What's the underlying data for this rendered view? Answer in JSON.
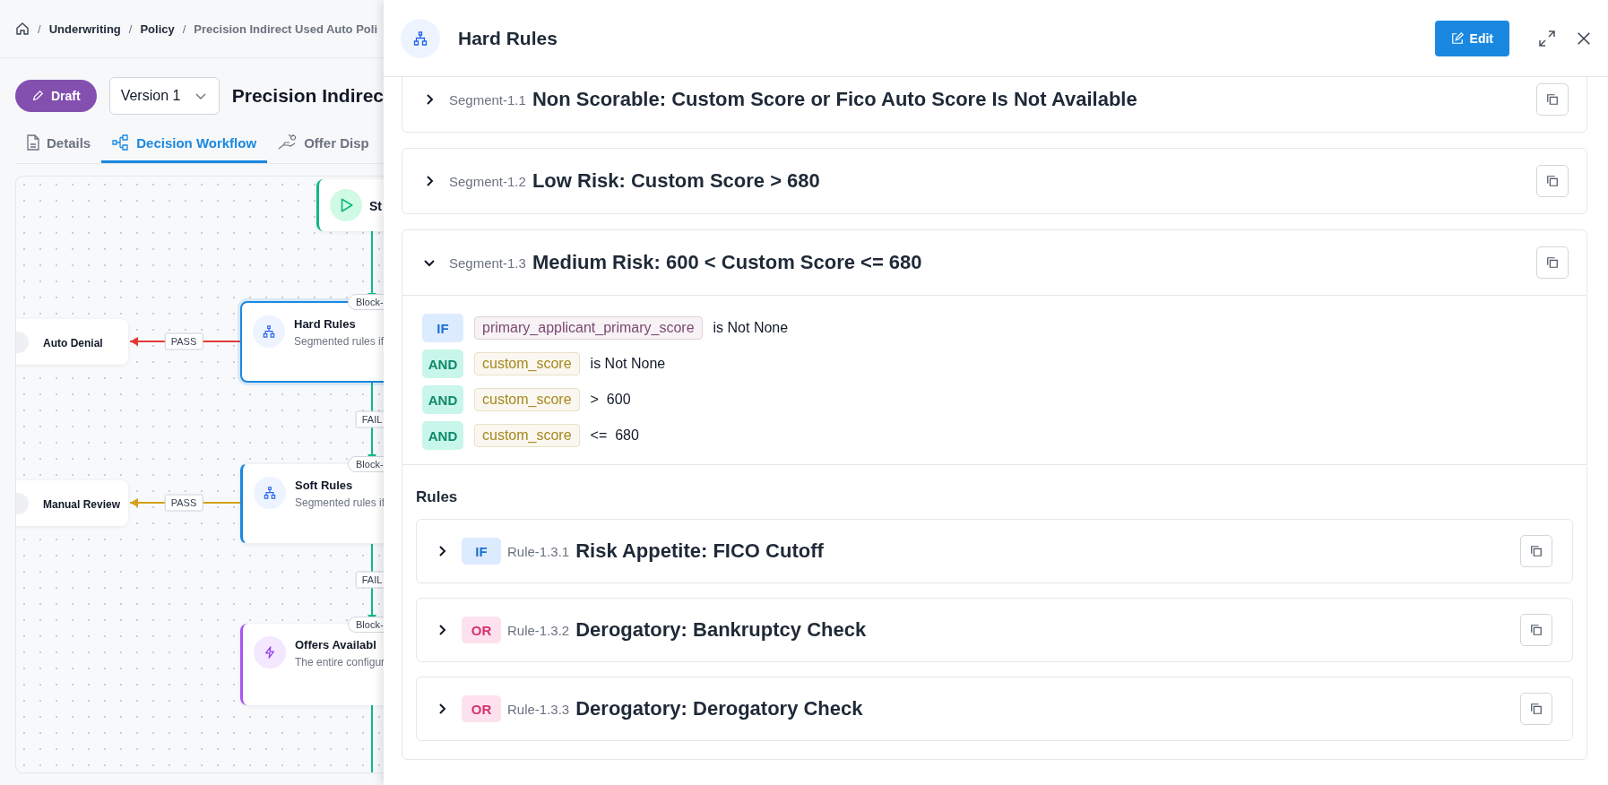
{
  "breadcrumb": {
    "separator": "/",
    "items": [
      {
        "label": "Underwriting",
        "current": false
      },
      {
        "label": "Policy",
        "current": false
      },
      {
        "label": "Precision Indirect Used Auto Poli",
        "current": true
      }
    ]
  },
  "status_badge": "Draft",
  "version_select": {
    "value": "Version 1"
  },
  "policy_title": "Precision Indirec",
  "tabs": [
    {
      "kind": "details",
      "label": "Details",
      "selected": false
    },
    {
      "kind": "workflow",
      "label": "Decision Workflow",
      "selected": true
    },
    {
      "kind": "offer",
      "label": "Offer Disp",
      "selected": false
    }
  ],
  "workflow": {
    "nodes": [
      {
        "kind": "start",
        "title": "St"
      },
      {
        "kind": "outcome",
        "title": "Auto Denial"
      },
      {
        "kind": "rules",
        "title": "Hard Rules",
        "subtitle": "Segmented rules if",
        "block_label": "Block-",
        "selected": true
      },
      {
        "kind": "outcome",
        "title": "Manual Review"
      },
      {
        "kind": "rules",
        "title": "Soft Rules",
        "subtitle": "Segmented rules if",
        "block_label": "Block-",
        "selected": false
      },
      {
        "kind": "offers",
        "title": "Offers Availabl",
        "subtitle": "The entire configur",
        "block_label": "Block-"
      }
    ],
    "edges": [
      {
        "label": "PASS",
        "color": "#e53935"
      },
      {
        "label": "FAIL",
        "color": "#10b981"
      },
      {
        "label": "PASS",
        "color": "#d4a017"
      },
      {
        "label": "FAIL",
        "color": "#10b981"
      }
    ]
  },
  "drawer": {
    "title": "Hard Rules",
    "edit_button": "Edit",
    "segments": [
      {
        "id": "Segment-1.1",
        "title": "Non Scorable: Custom Score or Fico Auto Score Is Not Available",
        "expanded": false
      },
      {
        "id": "Segment-1.2",
        "title": "Low Risk: Custom Score > 680",
        "expanded": false
      },
      {
        "id": "Segment-1.3",
        "title": "Medium Risk: 600 < Custom Score <= 680",
        "expanded": true,
        "conditions": [
          {
            "kind": "if",
            "operator": "IF",
            "field": "primary_applicant_primary_score",
            "color": "#7b4a70",
            "comparison": "is Not None"
          },
          {
            "kind": "and",
            "operator": "AND",
            "field": "custom_score",
            "color": "#a8871d",
            "comparison": "is Not None"
          },
          {
            "kind": "and",
            "operator": "AND",
            "field": "custom_score",
            "color": "#a8871d",
            "comparison": ">  600"
          },
          {
            "kind": "and",
            "operator": "AND",
            "field": "custom_score",
            "color": "#a8871d",
            "comparison": "<=  680"
          }
        ],
        "rules_heading": "Rules",
        "rules": [
          {
            "kind": "if",
            "operator": "IF",
            "id": "Rule-1.3.1",
            "title": "Risk Appetite: FICO Cutoff",
            "expanded": false
          },
          {
            "kind": "or",
            "operator": "OR",
            "id": "Rule-1.3.2",
            "title": "Derogatory: Bankruptcy Check",
            "expanded": false
          },
          {
            "kind": "or",
            "operator": "OR",
            "id": "Rule-1.3.3",
            "title": "Derogatory: Derogatory Check",
            "expanded": false
          }
        ]
      }
    ]
  }
}
